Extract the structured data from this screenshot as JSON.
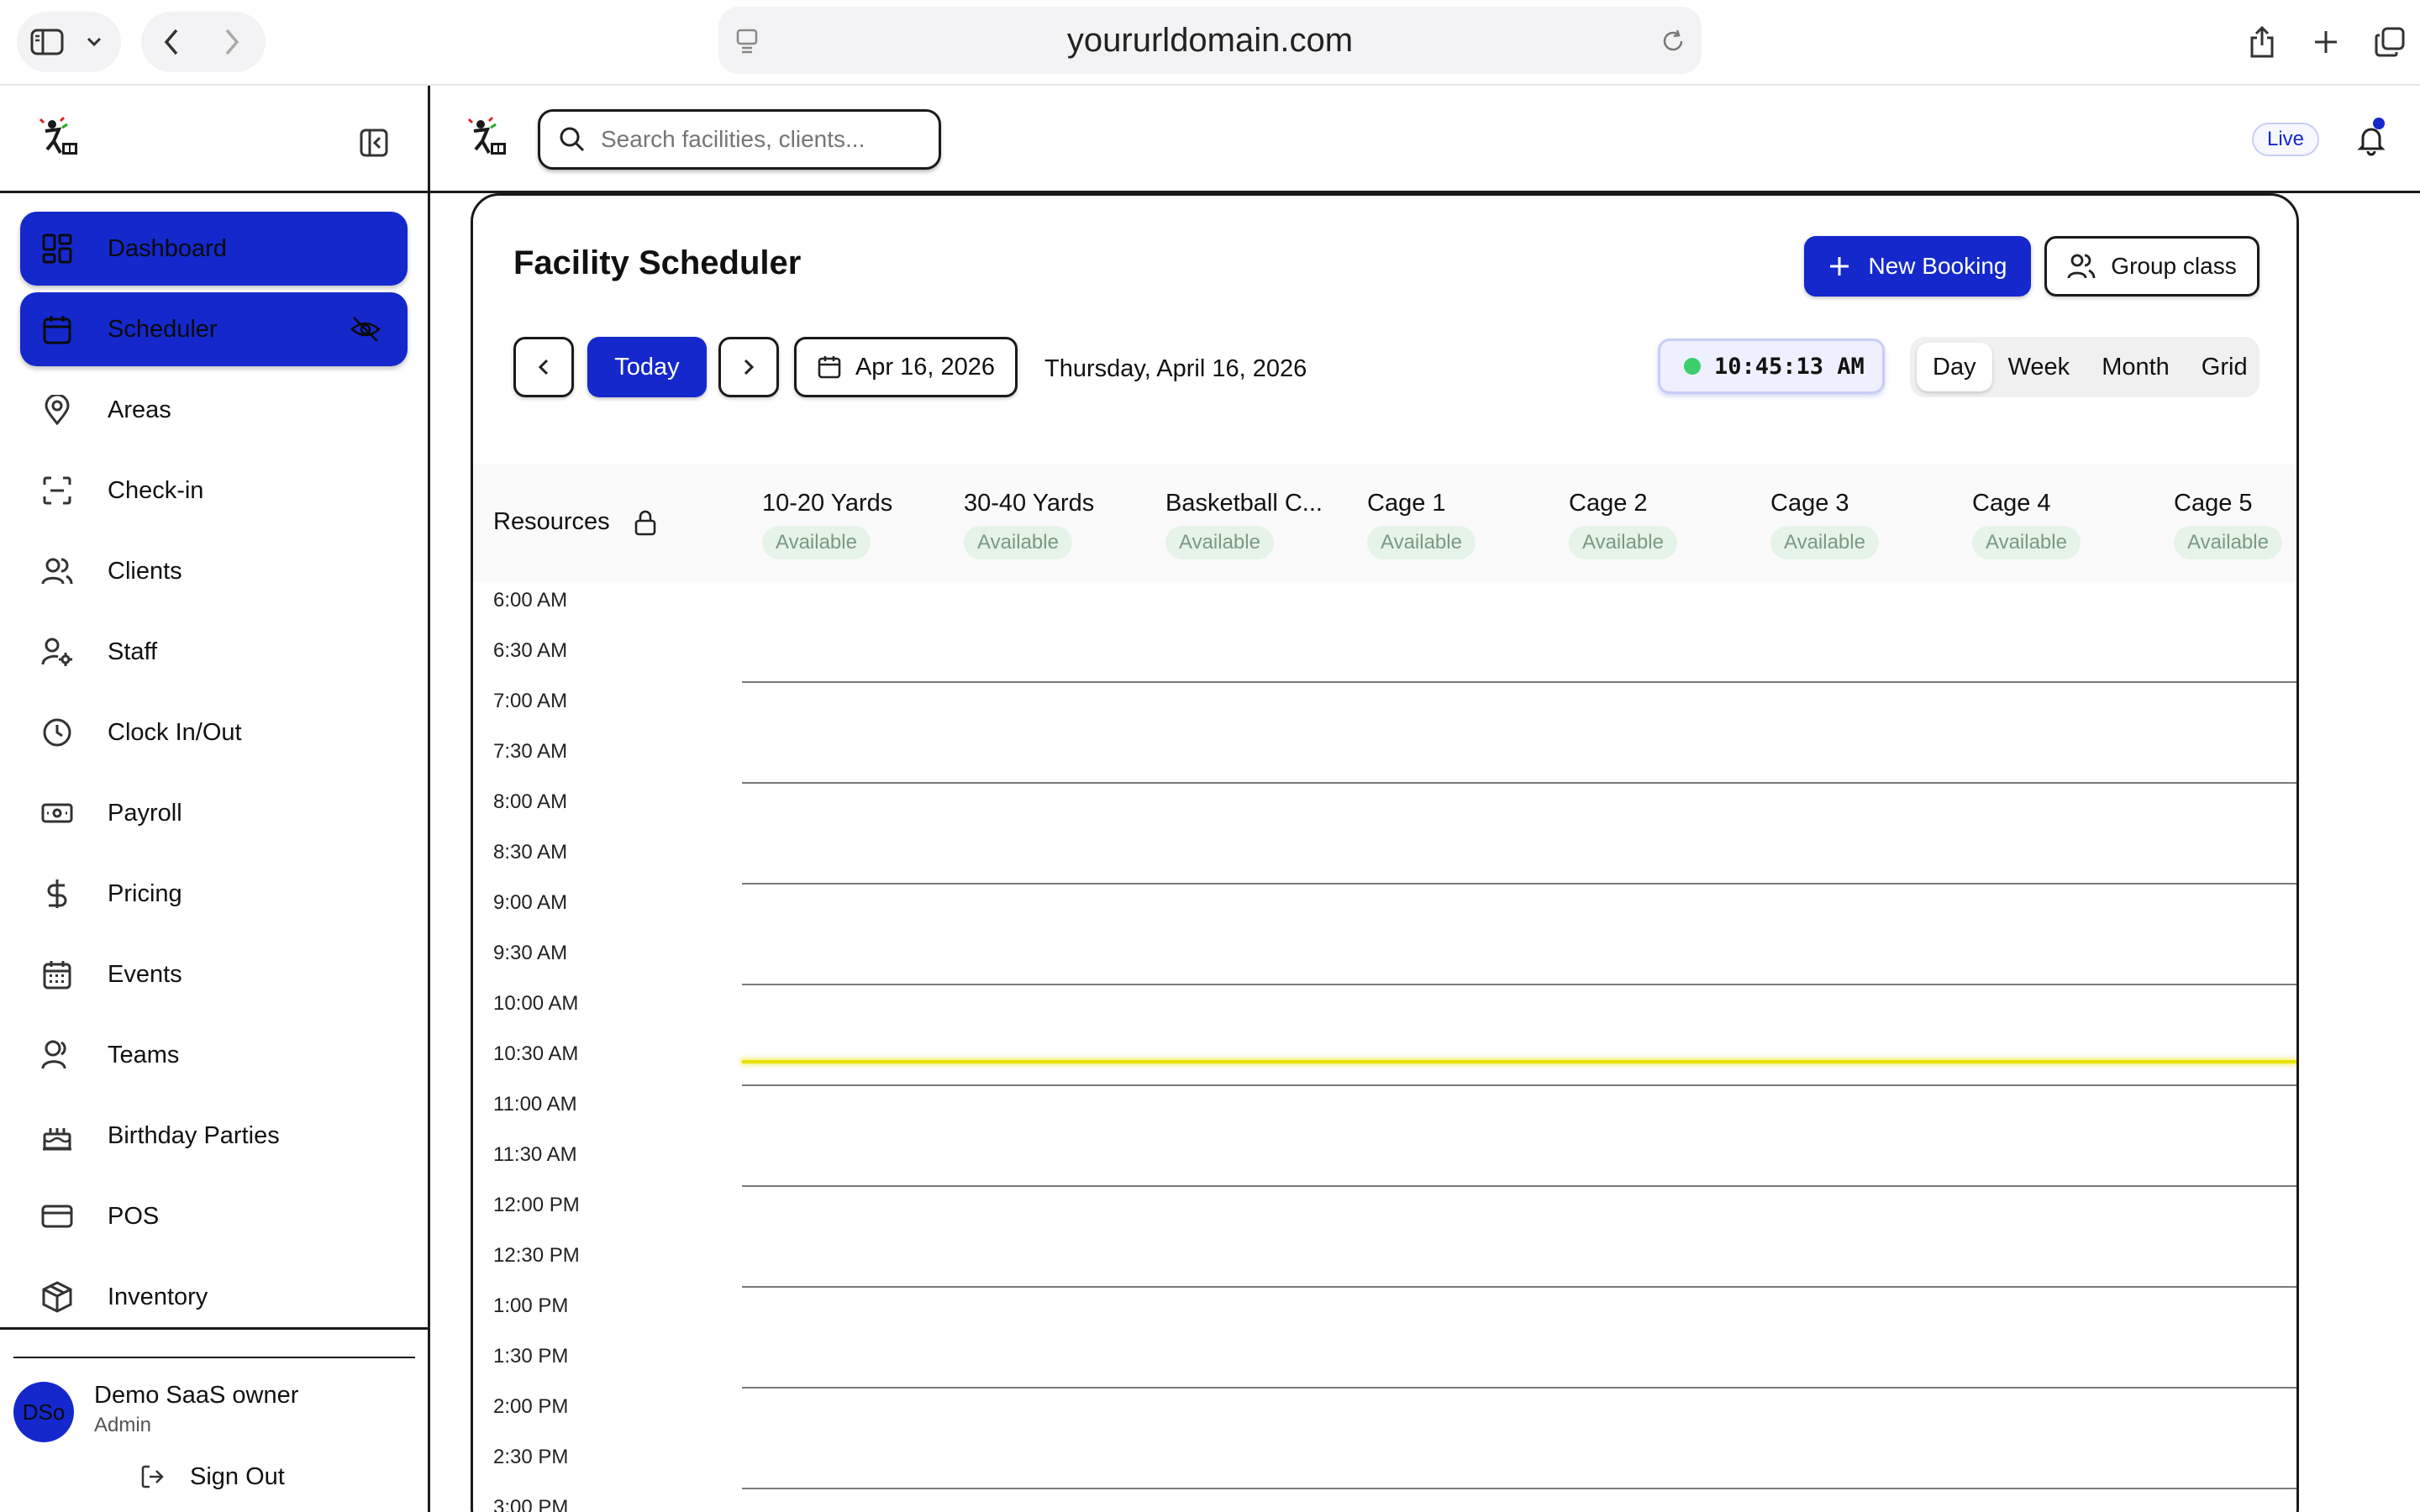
{
  "browser": {
    "url": "yoururldomain.com"
  },
  "sidebar": {
    "items": [
      {
        "label": "Dashboard",
        "icon": "dashboard-icon",
        "active": true
      },
      {
        "label": "Scheduler",
        "icon": "calendar-icon",
        "active": true
      },
      {
        "label": "Areas",
        "icon": "map-pin-icon"
      },
      {
        "label": "Check-in",
        "icon": "scan-icon"
      },
      {
        "label": "Clients",
        "icon": "users-icon"
      },
      {
        "label": "Staff",
        "icon": "user-gear-icon"
      },
      {
        "label": "Clock In/Out",
        "icon": "clock-icon"
      },
      {
        "label": "Payroll",
        "icon": "banknote-icon"
      },
      {
        "label": "Pricing",
        "icon": "dollar-icon"
      },
      {
        "label": "Events",
        "icon": "calendar-days-icon"
      },
      {
        "label": "Teams",
        "icon": "user-icon"
      },
      {
        "label": "Birthday Parties",
        "icon": "cake-icon"
      },
      {
        "label": "POS",
        "icon": "credit-card-icon"
      },
      {
        "label": "Inventory",
        "icon": "package-icon"
      }
    ],
    "user": {
      "initials": "DSo",
      "name": "Demo SaaS owner",
      "role": "Admin"
    },
    "sign_out": "Sign Out"
  },
  "topbar": {
    "search_placeholder": "Search facilities, clients...",
    "live": "Live"
  },
  "scheduler": {
    "title": "Facility Scheduler",
    "new_booking": "New Booking",
    "group_class": "Group class",
    "today": "Today",
    "date_short": "Apr 16, 2026",
    "date_long": "Thursday, April 16, 2026",
    "clock": "10:45:13 AM",
    "views": [
      "Day",
      "Week",
      "Month",
      "Grid"
    ],
    "active_view": "Day",
    "resources_label": "Resources",
    "columns": [
      {
        "name": "10-20 Yards",
        "status": "Available"
      },
      {
        "name": "30-40 Yards",
        "status": "Available"
      },
      {
        "name": "Basketball C...",
        "status": "Available"
      },
      {
        "name": "Cage 1",
        "status": "Available"
      },
      {
        "name": "Cage 2",
        "status": "Available"
      },
      {
        "name": "Cage 3",
        "status": "Available"
      },
      {
        "name": "Cage 4",
        "status": "Available"
      },
      {
        "name": "Cage 5",
        "status": "Available"
      }
    ],
    "times": [
      "6:00 AM",
      "6:30 AM",
      "7:00 AM",
      "7:30 AM",
      "8:00 AM",
      "8:30 AM",
      "9:00 AM",
      "9:30 AM",
      "10:00 AM",
      "10:30 AM",
      "11:00 AM",
      "11:30 AM",
      "12:00 PM",
      "12:30 PM",
      "1:00 PM",
      "1:30 PM",
      "2:00 PM",
      "2:30 PM",
      "3:00 PM"
    ]
  },
  "colors": {
    "accent": "#1428cc",
    "now_line": "#e8e000",
    "available_bg": "#e6f3e9",
    "available_text": "#7b9a82"
  }
}
